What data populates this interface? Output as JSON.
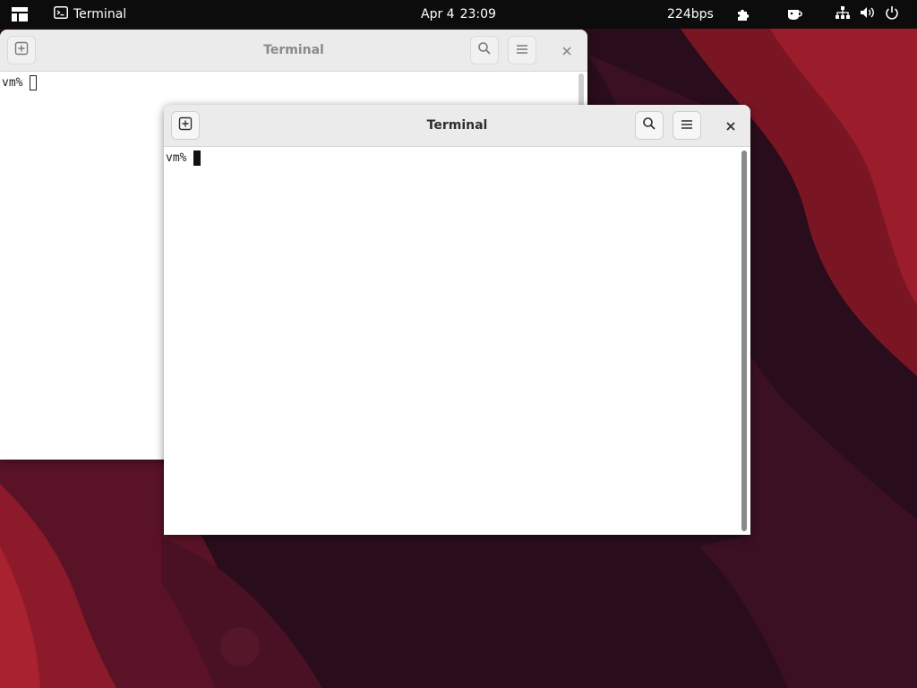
{
  "topbar": {
    "apps_icon": "apps-grid-icon",
    "app_menu": {
      "icon": "terminal-icon",
      "label": "Terminal"
    },
    "clock": {
      "date": "Apr 4",
      "time": "23:09"
    },
    "net_rate": "224bps",
    "extension_icon": "puzzle-icon",
    "coffee_icon": "coffee-cup-icon",
    "network_icon": "network-icon",
    "volume_icon": "volume-icon",
    "power_icon": "power-icon"
  },
  "windows": [
    {
      "id": "back",
      "title": "Terminal",
      "state": "inactive",
      "buttons": [
        "new-tab-icon",
        "search-icon",
        "menu-icon",
        "close-icon"
      ],
      "prompt": "vm%"
    },
    {
      "id": "front",
      "title": "Terminal",
      "state": "active",
      "buttons": [
        "new-tab-icon",
        "search-icon",
        "menu-icon",
        "close-icon"
      ],
      "prompt": "vm%"
    }
  ],
  "colors": {
    "topbar_bg": "#0c0c0c",
    "wallpaper_dark": "#2a0d1c",
    "wallpaper_red": "#8c1a2a",
    "header_bg": "#ebebeb"
  }
}
